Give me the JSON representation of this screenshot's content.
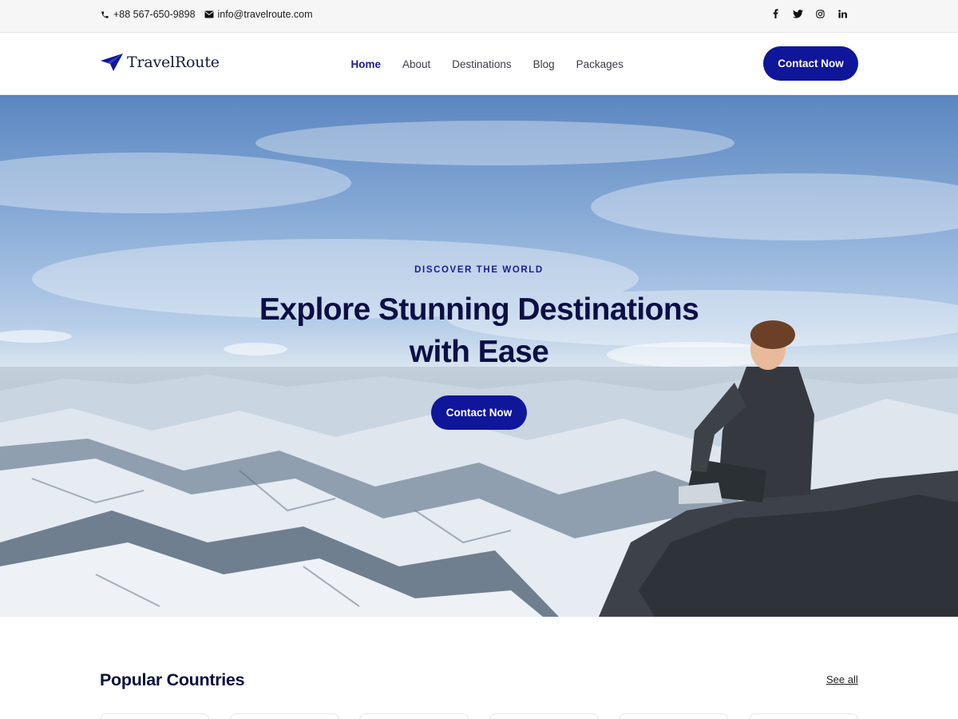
{
  "topbar": {
    "phone": "+88 567-650-9898",
    "email": "info@travelroute.com",
    "social": [
      "facebook-icon",
      "twitter-icon",
      "instagram-icon",
      "linkedin-icon"
    ]
  },
  "header": {
    "logo_text": "TravelRoute",
    "nav": [
      {
        "label": "Home",
        "active": true
      },
      {
        "label": "About",
        "active": false
      },
      {
        "label": "Destinations",
        "active": false
      },
      {
        "label": "Blog",
        "active": false
      },
      {
        "label": "Packages",
        "active": false
      }
    ],
    "cta_label": "Contact Now"
  },
  "hero": {
    "eyebrow": "DISCOVER THE WORLD",
    "title": "Explore Stunning Destinations with Ease",
    "cta_label": "Contact Now"
  },
  "popular": {
    "title": "Popular Countries",
    "see_all": "See all"
  },
  "colors": {
    "accent": "#10169a",
    "heading": "#0c0f45",
    "topbar_bg": "#f6f6f6"
  }
}
